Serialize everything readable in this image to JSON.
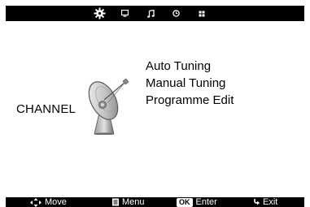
{
  "top_tabs": [
    {
      "icon": "gear-icon",
      "active": true
    },
    {
      "icon": "tv-picture-icon",
      "active": false
    },
    {
      "icon": "music-note-icon",
      "active": false
    },
    {
      "icon": "clock-icon",
      "active": false
    },
    {
      "icon": "grid-icon",
      "active": false
    }
  ],
  "section": {
    "label": "CHANNEL",
    "icon": "satellite-dish-icon"
  },
  "menu": {
    "items": [
      {
        "label": "Auto Tuning"
      },
      {
        "label": "Manual Tuning"
      },
      {
        "label": "Programme Edit"
      }
    ]
  },
  "footer": {
    "move": {
      "icon": "arrows-icon",
      "label": "Move"
    },
    "menu": {
      "icon": "menu-icon",
      "label": "Menu"
    },
    "enter": {
      "badge": "OK",
      "label": "Enter"
    },
    "exit": {
      "icon": "return-icon",
      "label": "Exit"
    }
  },
  "colors": {
    "bar": "#000000",
    "background": "#ffffff",
    "text": "#000000"
  }
}
